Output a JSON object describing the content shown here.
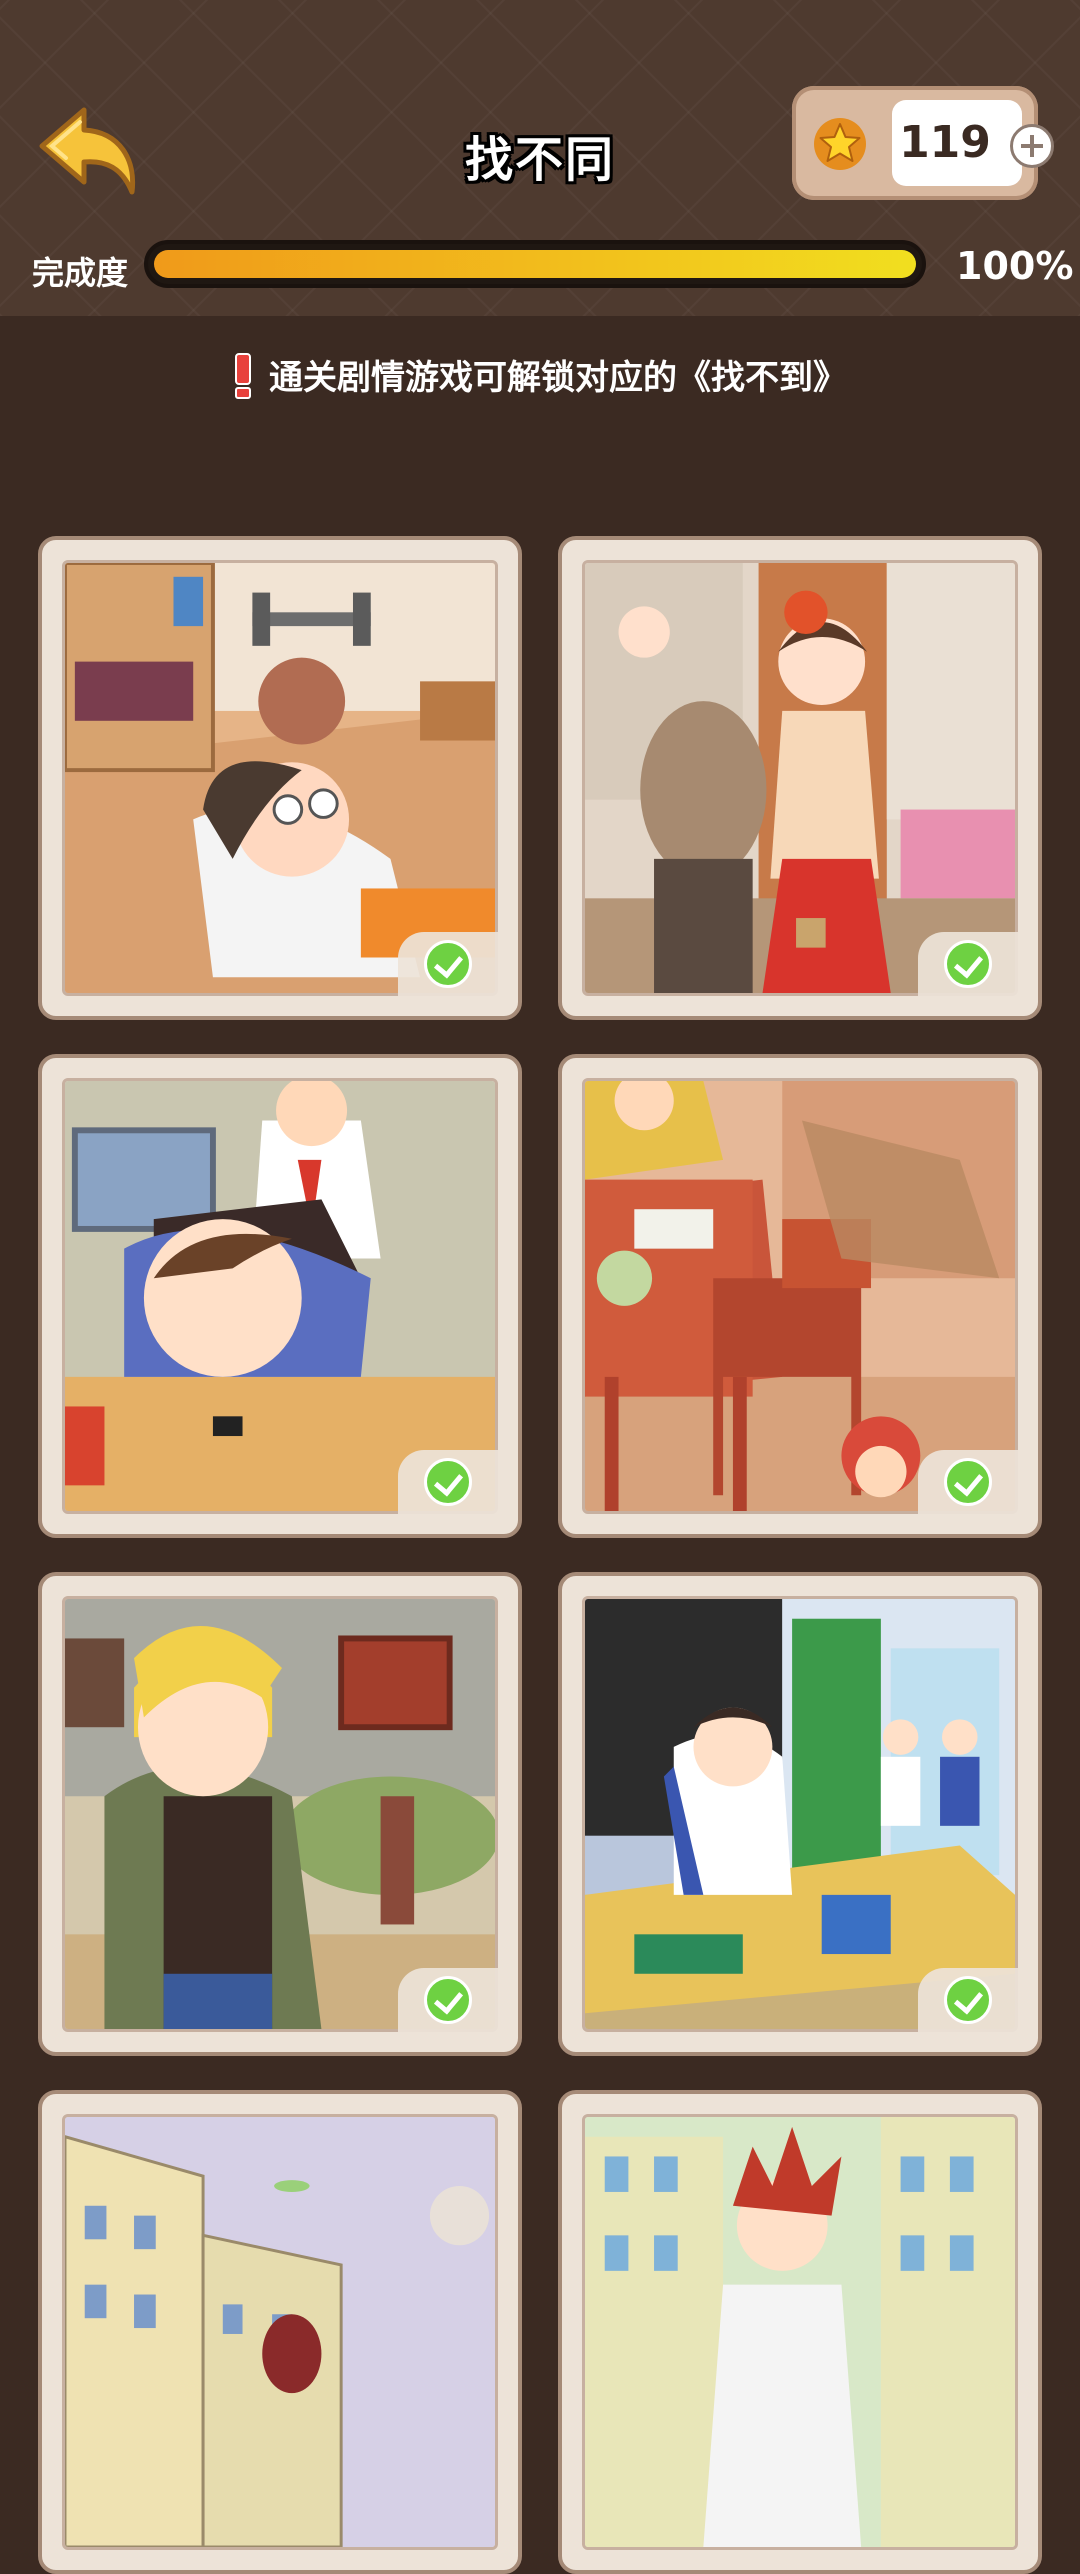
{
  "header": {
    "title": "找不同",
    "back_icon": "back-arrow-icon",
    "coins": {
      "icon": "star-icon",
      "value": "119",
      "add_icon": "plus-icon"
    }
  },
  "progress": {
    "label": "完成度",
    "percent_text": "100%",
    "value": 1.0
  },
  "notice": {
    "icon": "exclamation-icon",
    "text": "通关剧情游戏可解锁对应的《找不到》"
  },
  "levels": [
    {
      "scene": "boy-asleep-on-floor-bedroom",
      "completed": true
    },
    {
      "scene": "woman-in-red-skirt-at-door",
      "completed": true
    },
    {
      "scene": "boys-wrestling-on-floor",
      "completed": true
    },
    {
      "scene": "dining-room-with-rocking-chair",
      "completed": true
    },
    {
      "scene": "blonde-man-in-camo-jacket",
      "completed": true
    },
    {
      "scene": "classroom-student-at-blackboard",
      "completed": true
    },
    {
      "scene": "street-buildings-scene",
      "completed": false
    },
    {
      "scene": "red-haired-boy-street",
      "completed": false
    }
  ],
  "colors": {
    "accent": "#f2c21c",
    "check": "#6ed142",
    "background": "#3b2a22"
  }
}
